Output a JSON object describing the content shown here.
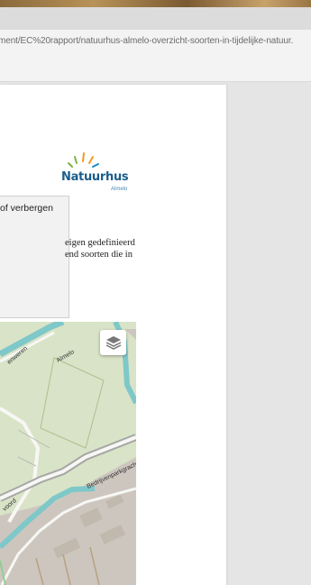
{
  "browser": {
    "url": "ment/EC%20rapport/natuurhus-almelo-overzicht-soorten-in-tijdelijke-natuur."
  },
  "logo": {
    "wordmark": "Natuurhus",
    "subtitle": "Almelo"
  },
  "popup": {
    "text": "of verbergen"
  },
  "intro": {
    "line1": "eigen gedefinieerd",
    "line2": "end soorten die in"
  },
  "map": {
    "labels": {
      "road1": "Almelo",
      "road2": "Bedrijvenparkgracht",
      "road3": "voord",
      "road4": "enweren"
    },
    "layers_icon": "layers-icon",
    "colors": {
      "water": "#7ec8c9",
      "park": "#d9e3c7",
      "built": "#cdc6bf",
      "road": "#f7f7f4"
    }
  },
  "colors": {
    "logo_blue": "#1b5e8c",
    "logo_green": "#7bb543",
    "logo_orange": "#f39a1e"
  }
}
